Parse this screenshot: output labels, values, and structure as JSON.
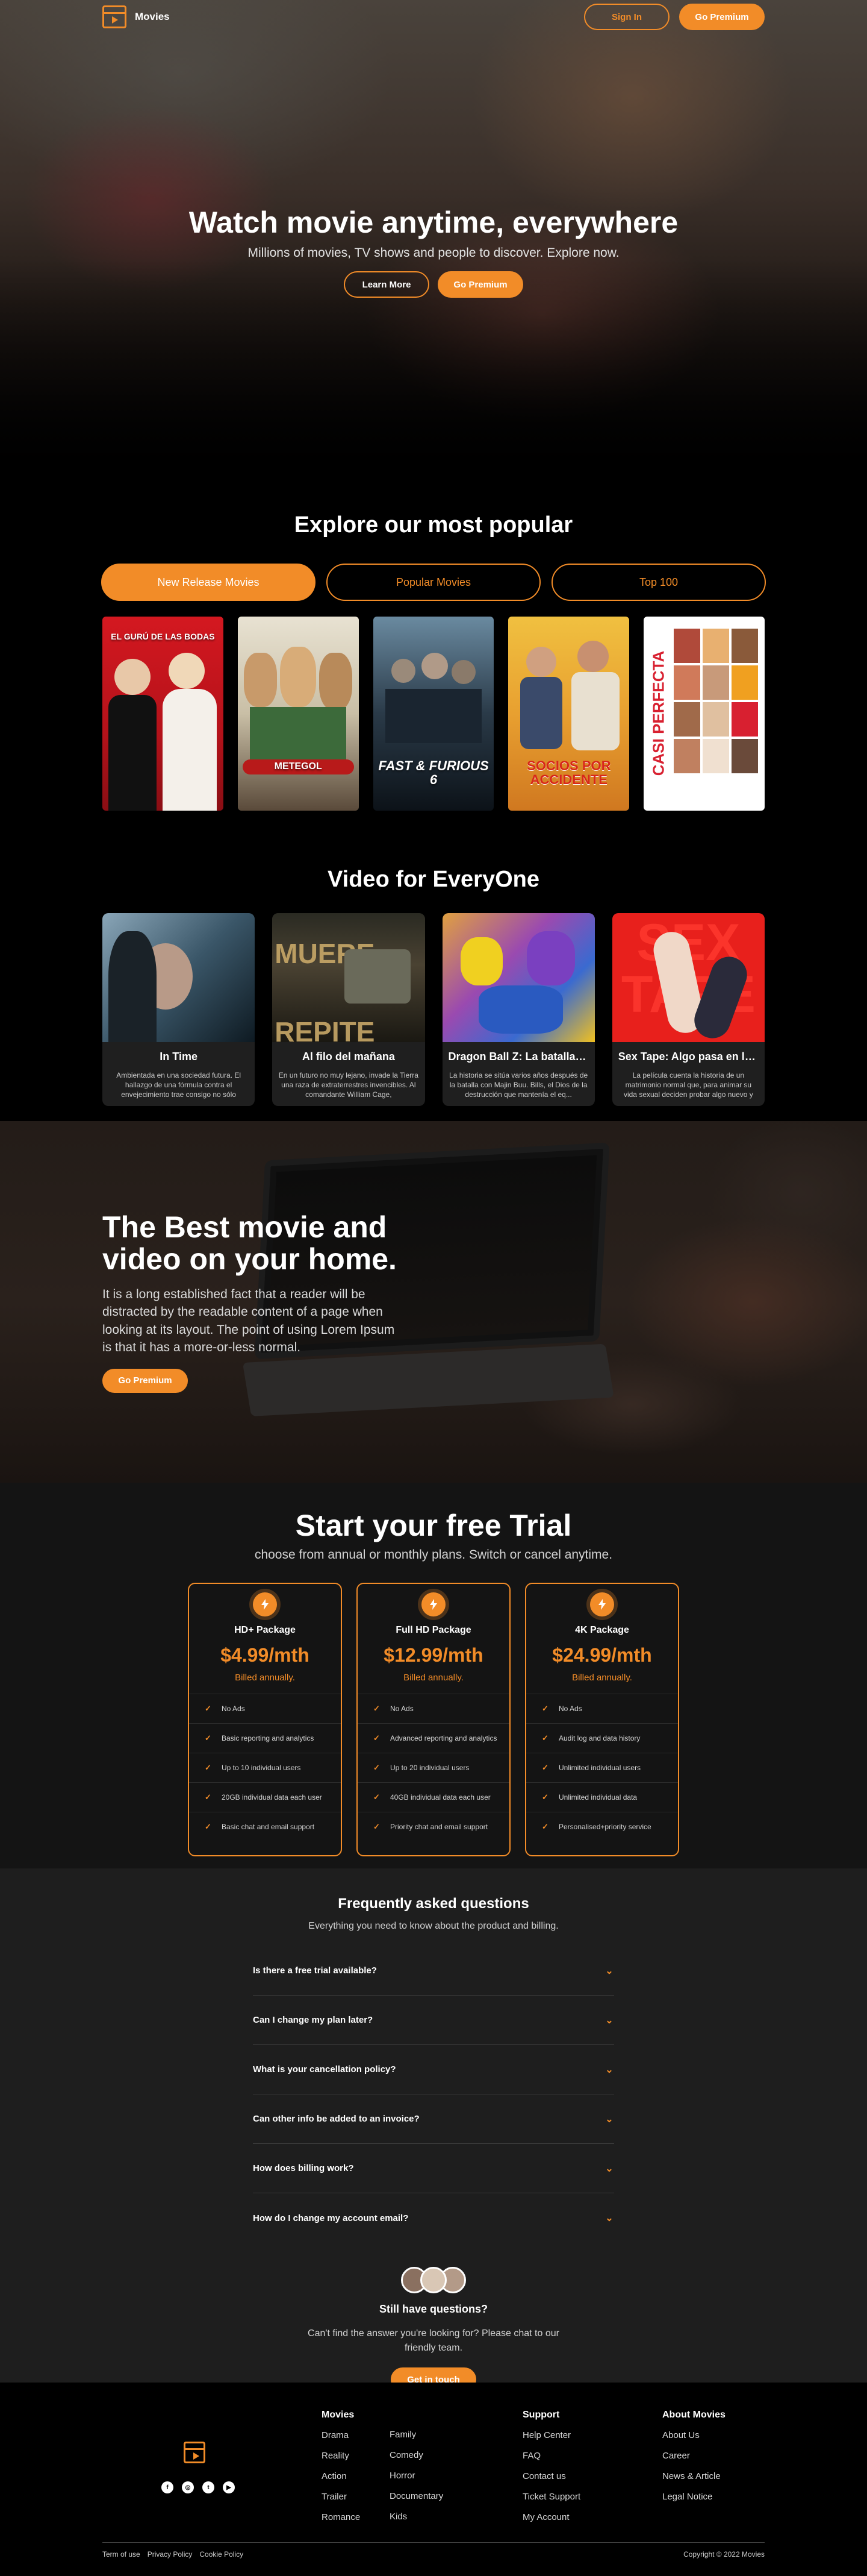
{
  "brand": {
    "name": "Movies"
  },
  "nav": {
    "sign_in": "Sign In",
    "premium": "Go Premium"
  },
  "hero": {
    "title": "Watch movie anytime, everywhere",
    "subtitle": "Millions of movies, TV shows and people to discover. Explore now.",
    "learn_more": "Learn More",
    "premium": "Go Premium"
  },
  "popular": {
    "title": "Explore our most popular",
    "tabs": [
      "New Release Movies",
      "Popular Movies",
      "Top 100"
    ],
    "active_tab": 0,
    "posters": [
      {
        "title": "EL GURÚ DE LAS BODAS",
        "color": "#c8141c"
      },
      {
        "title": "METEGOL",
        "color": "#d8d2c0"
      },
      {
        "title": "FAST & FURIOUS 6",
        "color": "#3a4b5a"
      },
      {
        "title": "SOCIOS POR ACCIDENTE",
        "color": "#e89a2a"
      },
      {
        "title": "CASI PERFECTA",
        "color": "#ffffff"
      }
    ]
  },
  "video": {
    "title": "Video for EveryOne",
    "cards": [
      {
        "title": "In Time",
        "desc": "Ambientada en una sociedad futura. El hallazgo de una fórmula contra el envejecimiento trae consigo no sólo",
        "color": "#4a6b80"
      },
      {
        "title": "Al filo del mañana",
        "desc": "En un futuro no muy lejano, invade la Tierra una raza de extraterrestres invencibles. Al comandante William Cage,",
        "color": "#6a5a3c"
      },
      {
        "title": "Dragon Ball Z: La batalla de los dioses",
        "desc": "La historia se sitúa varios años después de la batalla con Majin Buu. Bills, el Dios de la destrucción que mantenía el eq...",
        "color": "#6a55b0"
      },
      {
        "title": "Sex Tape: Algo pasa en la nube",
        "desc": "La película cuenta la historia de un matrimonio normal que, para animar su vida sexual deciden probar algo nuevo y",
        "color": "#d8201c"
      }
    ]
  },
  "best": {
    "title": "The Best movie and video on your home.",
    "text": "It is a long established fact that a reader will be distracted by the readable content of a page when looking at its layout. The point of using Lorem Ipsum is that it has a more-or-less normal.",
    "button": "Go Premium"
  },
  "trial": {
    "title": "Start your free Trial",
    "subtitle": "choose from annual or monthly plans. Switch or cancel anytime.",
    "plans": [
      {
        "name": "HD+ Package",
        "price": "$4.99/mth",
        "billed": "Billed annually.",
        "features": [
          "No Ads",
          "Basic reporting and analytics",
          "Up to 10 individual users",
          "20GB individual data each user",
          "Basic chat and email support"
        ]
      },
      {
        "name": "Full HD Package",
        "price": "$12.99/mth",
        "billed": "Billed annually.",
        "features": [
          "No Ads",
          "Advanced reporting and analytics",
          "Up to 20 individual users",
          "40GB individual data each user",
          "Priority chat and email support"
        ]
      },
      {
        "name": "4K Package",
        "price": "$24.99/mth",
        "billed": "Billed annually.",
        "features": [
          "No Ads",
          "Audit log and data history",
          "Unlimited individual users",
          "Unlimited individual data",
          "Personalised+priority service"
        ]
      }
    ]
  },
  "faq": {
    "title": "Frequently asked questions",
    "subtitle": "Everything you need to know about the product and billing.",
    "items": [
      "Is there a free trial available?",
      "Can I change my plan later?",
      "What is your cancellation policy?",
      "Can other info be added to an invoice?",
      "How does billing work?",
      "How do I change my account email?"
    ],
    "still_title": "Still have questions?",
    "still_text": "Can't find the answer you're looking for? Please chat to our friendly team.",
    "button": "Get in touch"
  },
  "footer": {
    "cols": [
      {
        "title": "Movies",
        "links": [
          "Drama",
          "Reality",
          "Action",
          "Trailer",
          "Romance"
        ]
      },
      {
        "title": "",
        "links": [
          "Family",
          "Comedy",
          "Horror",
          "Documentary",
          "Kids"
        ]
      },
      {
        "title": "Support",
        "links": [
          "Help Center",
          "FAQ",
          "Contact us",
          "Ticket Support",
          "My Account"
        ]
      },
      {
        "title": "About Movies",
        "links": [
          "About Us",
          "Career",
          "News & Article",
          "Legal Notice"
        ]
      }
    ],
    "bottom_links": [
      "Term of use",
      "Privacy Policy",
      "Cookie Policy"
    ],
    "copyright": "Copyright © 2022 Movies"
  },
  "colors": {
    "accent": "#f28c28",
    "background": "#000000"
  }
}
